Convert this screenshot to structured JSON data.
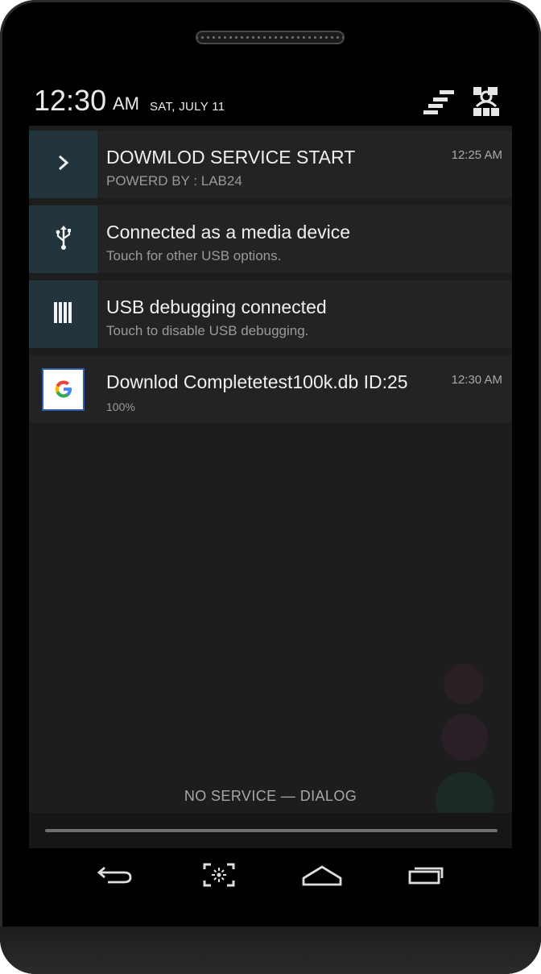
{
  "status_bar": {
    "time": "12:30",
    "ampm": "AM",
    "date": "SAT, JULY 11",
    "icons": [
      "settings-toggle-icon",
      "user-qs-icon"
    ]
  },
  "notifications": [
    {
      "title": "DOWMLOD SERVICE START",
      "subtitle": "POWERD BY : LAB24",
      "time": "12:25 AM",
      "icon": "chevron-right-icon"
    },
    {
      "title": "Connected as a media device",
      "subtitle": "Touch for other USB options.",
      "time": "",
      "icon": "usb-icon"
    },
    {
      "title": "USB debugging connected",
      "subtitle": "Touch to disable USB debugging.",
      "time": "",
      "icon": "debug-icon"
    },
    {
      "title": "Downlod Completetest100k.db ID:25",
      "subtitle": "100%",
      "time": "12:30 AM",
      "icon": "google-icon"
    }
  ],
  "footer": {
    "carrier_text": "NO SERVICE — DIALOG"
  },
  "nav_bar": {
    "buttons": [
      "back-icon",
      "screenshot-icon",
      "home-icon",
      "recents-icon"
    ]
  },
  "colors": {
    "shade_bg": "#1d1d1d",
    "notification_bg": "#232323",
    "icon_box_bg": "#22343c",
    "phone_frame": "#000000"
  }
}
